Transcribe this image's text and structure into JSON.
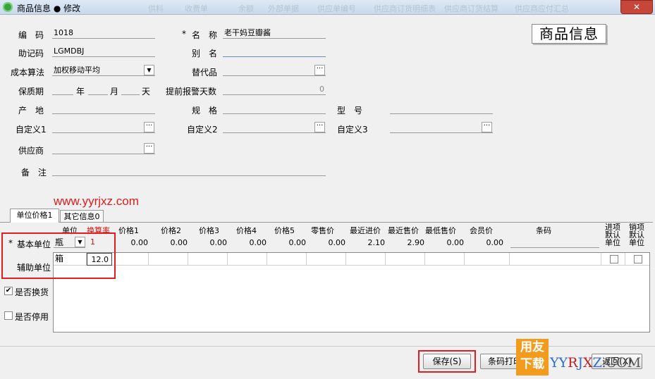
{
  "window": {
    "title": "商品信息 ● 修改",
    "ghost_tabs": [
      "供料",
      "收费单",
      "余额",
      "外部单据",
      "供应单编号",
      "供应商订货明细表",
      "供应商订货结算",
      "供应商应付汇总"
    ],
    "close_label": "✕"
  },
  "form": {
    "code": {
      "label": "编　码",
      "value": "1018"
    },
    "name": {
      "label": "名　称",
      "required": "*",
      "value": "老干妈豆瓣酱"
    },
    "mnemonic": {
      "label": "助记码",
      "value": "LGMDBJ"
    },
    "alias": {
      "label": "别　名",
      "value": ""
    },
    "cost_method": {
      "label": "成本算法",
      "value": "加权移动平均"
    },
    "substitute": {
      "label": "替代品",
      "value": ""
    },
    "shelf_life": {
      "label": "保质期",
      "year": "年",
      "month": "月",
      "day": "天"
    },
    "warn_days": {
      "label": "提前报警天数",
      "value": "0"
    },
    "origin": {
      "label": "产　地",
      "value": ""
    },
    "spec": {
      "label": "规　格",
      "value": ""
    },
    "model": {
      "label": "型　号",
      "value": ""
    },
    "custom1": {
      "label": "自定义1",
      "value": ""
    },
    "custom2": {
      "label": "自定义2",
      "value": ""
    },
    "custom3": {
      "label": "自定义3",
      "value": ""
    },
    "supplier": {
      "label": "供应商",
      "value": ""
    },
    "remark": {
      "label": "备　注",
      "value": ""
    },
    "dots": "···"
  },
  "stamp": "商品信息",
  "watermark": "www.yyrjxz.com",
  "tabs": {
    "unit_price": "单位价格1",
    "other_info": "其它信息0"
  },
  "grid": {
    "headers": {
      "unit": "单位",
      "ratio": "换算率",
      "price1": "价格1",
      "price2": "价格2",
      "price3": "价格3",
      "price4": "价格4",
      "price5": "价格5",
      "retail": "零售价",
      "last_purchase": "最近进价",
      "last_sale": "最近售价",
      "min_sale": "最低售价",
      "member": "会员价",
      "barcode": "条码",
      "purchase_default": "进项默认单位",
      "sale_default": "销项默认单位"
    },
    "base_unit": {
      "label": "基本单位",
      "required": "*",
      "unit": "瓶",
      "ratio": "1",
      "prices": [
        "0.00",
        "0.00",
        "0.00",
        "0.00",
        "0.00",
        "0.00",
        "2.10",
        "2.90",
        "0.00",
        "0.00"
      ]
    },
    "aux_unit": {
      "label": "辅助单位",
      "unit": "箱",
      "ratio": "12.0"
    }
  },
  "options": {
    "exchange": {
      "label": "是否换货",
      "checked": true
    },
    "disabled": {
      "label": "是否停用",
      "checked": false
    }
  },
  "buttons": {
    "save": "保存(S)",
    "barcode_print": "条码打印",
    "return": "返回(X)"
  },
  "logo": {
    "line1": "用友",
    "line2": "下载",
    "text_y": "YY",
    "text_r": "R",
    "text_j": "J",
    "text_x": "X",
    "text_z": "Z",
    "text_com": ".COM"
  }
}
